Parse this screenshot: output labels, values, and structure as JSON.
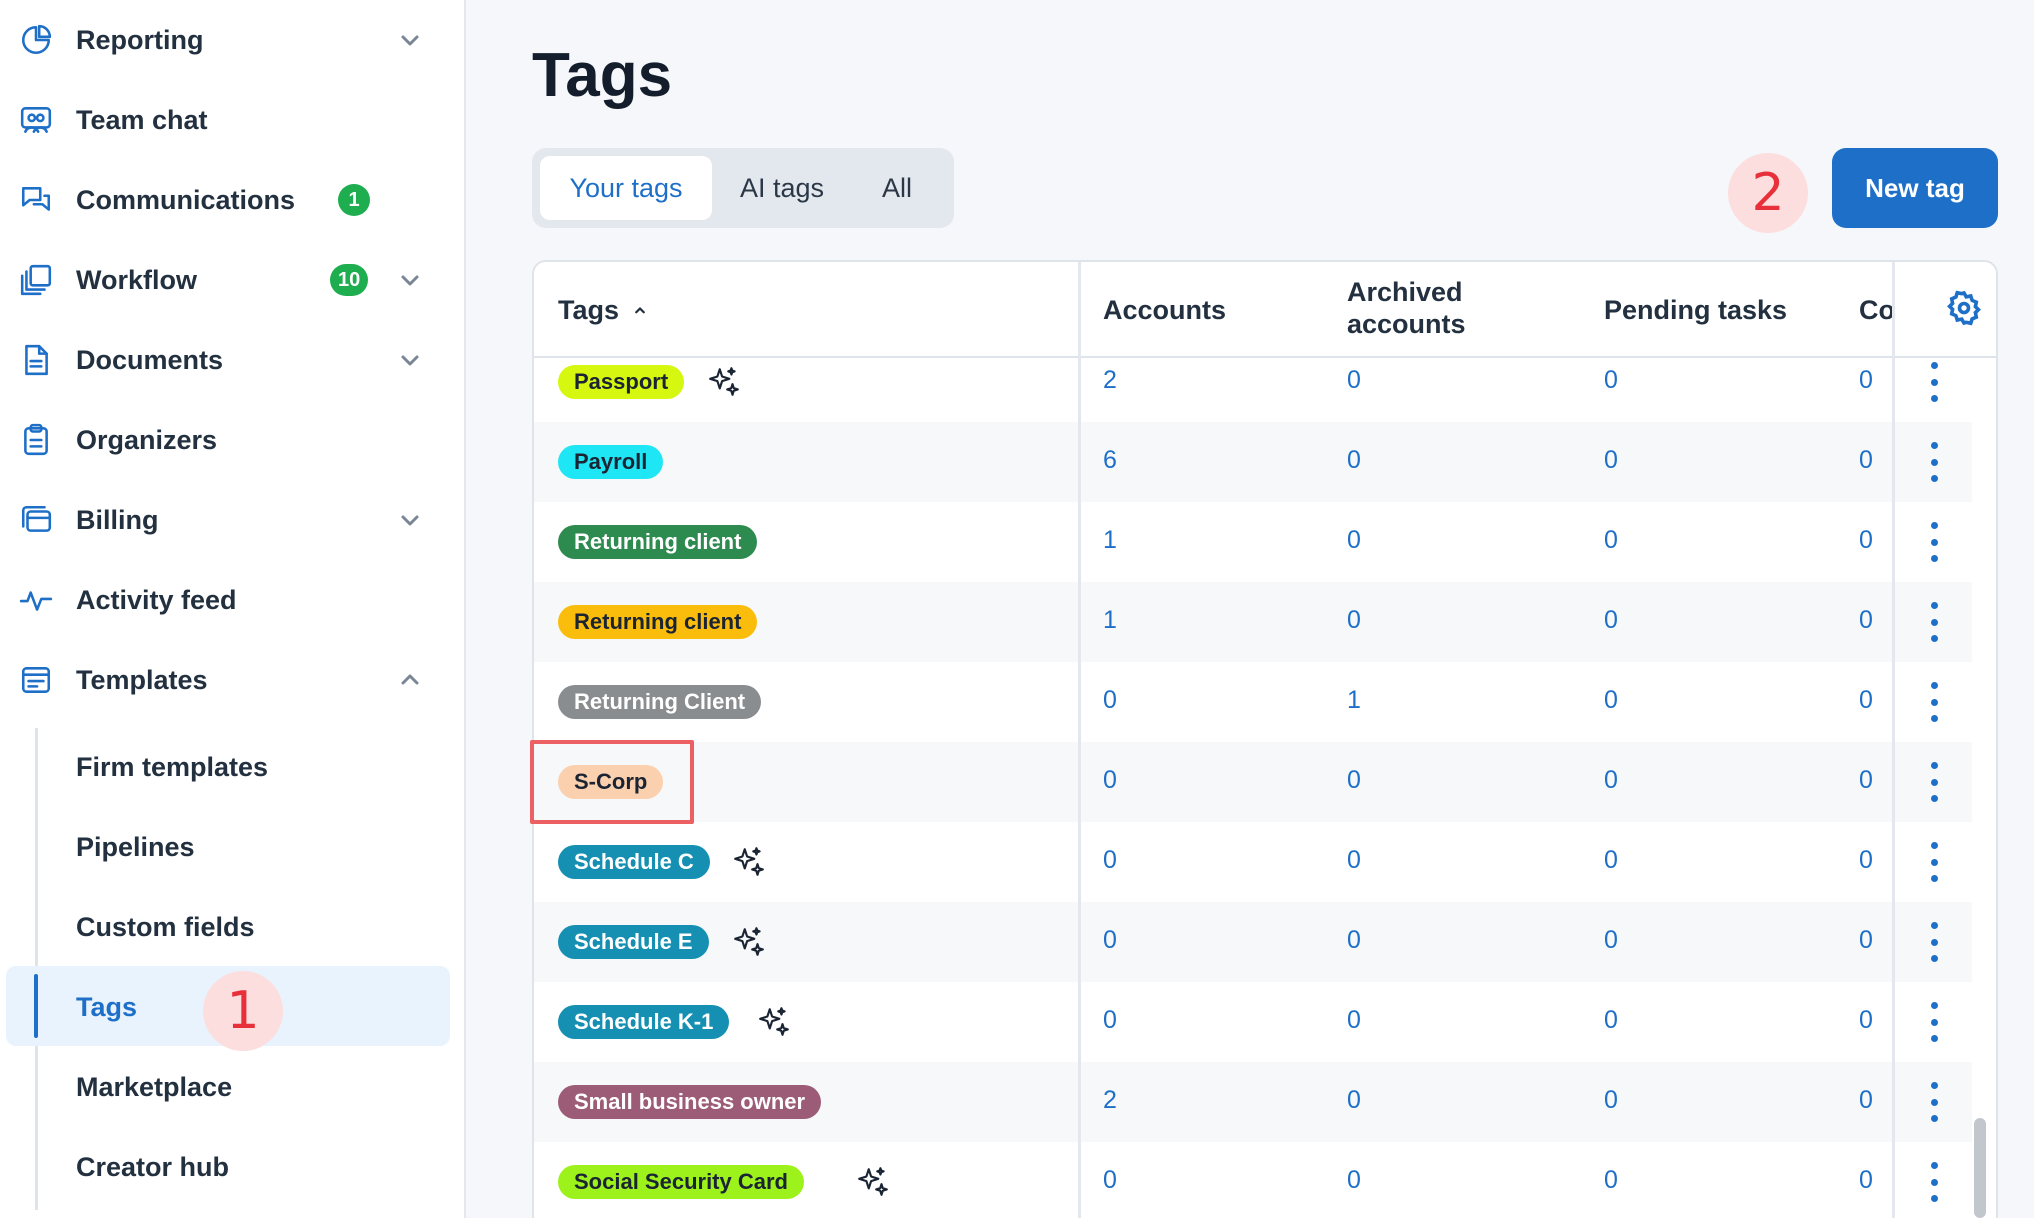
{
  "sidebar": {
    "items": [
      {
        "label": "Reporting",
        "icon": "pie-chart-icon",
        "chevron": "down"
      },
      {
        "label": "Team chat",
        "icon": "team-chat-icon"
      },
      {
        "label": "Communications",
        "icon": "chat-bubbles-icon",
        "badge": "1"
      },
      {
        "label": "Workflow",
        "icon": "workflow-icon",
        "badge": "10",
        "chevron": "down"
      },
      {
        "label": "Documents",
        "icon": "document-icon",
        "chevron": "down"
      },
      {
        "label": "Organizers",
        "icon": "clipboard-icon"
      },
      {
        "label": "Billing",
        "icon": "billing-icon",
        "chevron": "down"
      },
      {
        "label": "Activity feed",
        "icon": "activity-icon"
      },
      {
        "label": "Templates",
        "icon": "templates-icon",
        "chevron": "up"
      }
    ],
    "subitems": [
      {
        "label": "Firm templates"
      },
      {
        "label": "Pipelines"
      },
      {
        "label": "Custom fields"
      },
      {
        "label": "Tags",
        "active": true
      },
      {
        "label": "Marketplace"
      },
      {
        "label": "Creator hub"
      }
    ]
  },
  "markers": {
    "one": "1",
    "two": "2"
  },
  "main": {
    "title": "Tags",
    "tabs": [
      {
        "label": "Your tags",
        "active": true
      },
      {
        "label": "AI tags"
      },
      {
        "label": "All"
      }
    ],
    "new_tag_label": "New tag"
  },
  "table": {
    "columns": {
      "tags": "Tags",
      "accounts": "Accounts",
      "archived_line1": "Archived",
      "archived_line2": "accounts",
      "pending": "Pending tasks",
      "co": "Co"
    },
    "rows": [
      {
        "tag": "Passport",
        "bg": "#d6f70f",
        "fg": "#1a2433",
        "ai": true,
        "accounts": "2",
        "archived": "0",
        "pending": "0",
        "co": "0"
      },
      {
        "tag": "Payroll",
        "bg": "#1fe6f5",
        "fg": "#1a2433",
        "ai": false,
        "accounts": "6",
        "archived": "0",
        "pending": "0",
        "co": "0"
      },
      {
        "tag": "Returning client",
        "bg": "#2e8b4f",
        "fg": "#ffffff",
        "ai": false,
        "accounts": "1",
        "archived": "0",
        "pending": "0",
        "co": "0"
      },
      {
        "tag": "Returning client",
        "bg": "#fbbd0c",
        "fg": "#1a2433",
        "ai": false,
        "accounts": "1",
        "archived": "0",
        "pending": "0",
        "co": "0"
      },
      {
        "tag": "Returning Client",
        "bg": "#8a8d90",
        "fg": "#ffffff",
        "ai": false,
        "accounts": "0",
        "archived": "1",
        "pending": "0",
        "co": "0"
      },
      {
        "tag": "S-Corp",
        "bg": "#fbd0ae",
        "fg": "#1a2433",
        "ai": false,
        "accounts": "0",
        "archived": "0",
        "pending": "0",
        "co": "0"
      },
      {
        "tag": "Schedule C",
        "bg": "#1590b3",
        "fg": "#ffffff",
        "ai": true,
        "accounts": "0",
        "archived": "0",
        "pending": "0",
        "co": "0"
      },
      {
        "tag": "Schedule E",
        "bg": "#1590b3",
        "fg": "#ffffff",
        "ai": true,
        "accounts": "0",
        "archived": "0",
        "pending": "0",
        "co": "0"
      },
      {
        "tag": "Schedule K-1",
        "bg": "#1590b3",
        "fg": "#ffffff",
        "ai": true,
        "accounts": "0",
        "archived": "0",
        "pending": "0",
        "co": "0"
      },
      {
        "tag": "Small business owner",
        "bg": "#9c5b76",
        "fg": "#ffffff",
        "ai": false,
        "accounts": "2",
        "archived": "0",
        "pending": "0",
        "co": "0"
      },
      {
        "tag": "Social Security Card",
        "bg": "#9ef21c",
        "fg": "#1a2433",
        "ai": true,
        "accounts": "0",
        "archived": "0",
        "pending": "0",
        "co": "0"
      }
    ]
  },
  "colors": {
    "accent": "#1e6fc7",
    "badge": "#1fae4f",
    "marker": "#e8303a",
    "highlight": "#ec5f62"
  }
}
